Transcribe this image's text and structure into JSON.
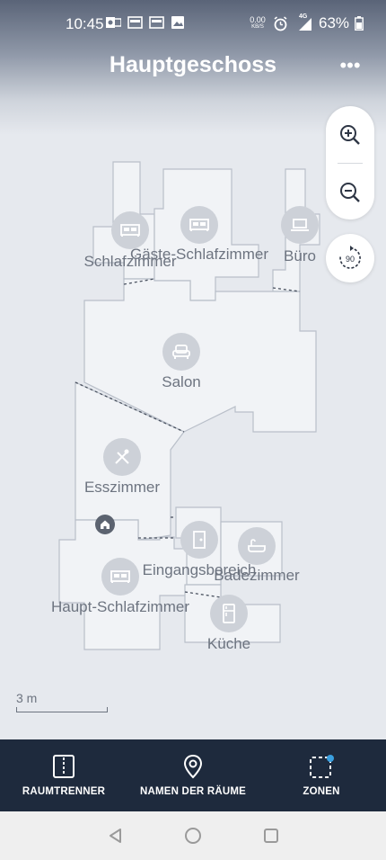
{
  "status_bar": {
    "time": "10:45",
    "net_speed_value": "0.00",
    "net_speed_unit": "KB/S",
    "network_type": "4G",
    "battery": "63%",
    "icons": [
      "outlook-icon",
      "news-icon",
      "news-icon",
      "image-icon",
      "alarm-icon",
      "signal-icon",
      "battery-icon"
    ]
  },
  "header": {
    "title": "Hauptgeschoss",
    "more_label": "•••"
  },
  "controls": {
    "zoom_in": "zoom-in-icon",
    "zoom_out": "zoom-out-icon",
    "rotate_label": "90"
  },
  "map": {
    "rooms": [
      {
        "name": "Schlafzimmer",
        "icon": "bed-icon"
      },
      {
        "name": "Gäste-Schlafzimmer",
        "icon": "bed-icon"
      },
      {
        "name": "Büro",
        "icon": "laptop-icon"
      },
      {
        "name": "Salon",
        "icon": "armchair-icon"
      },
      {
        "name": "Esszimmer",
        "icon": "cutlery-icon"
      },
      {
        "name": "Eingangsbereich",
        "icon": "door-icon"
      },
      {
        "name": "Badezimmer",
        "icon": "bathtub-icon"
      },
      {
        "name": "Haupt-Schlafzimmer",
        "icon": "bed-icon"
      },
      {
        "name": "Küche",
        "icon": "fridge-icon"
      }
    ],
    "dock": "home-icon",
    "scale": "3 m",
    "colors": {
      "room_fill": "#f1f3f6",
      "room_stroke": "#b9bfc9",
      "icon_circle": "#cdd1d8",
      "label": "#6d7480"
    }
  },
  "bottom_bar": {
    "items": [
      {
        "label": "RAUMTRENNER",
        "icon": "room-divider-icon"
      },
      {
        "label": "NAMEN DER RÄUME",
        "icon": "location-pin-icon"
      },
      {
        "label": "ZONEN",
        "icon": "zones-icon"
      }
    ],
    "background": "#1e2a3d",
    "notification_dot": "#3aa0e0"
  },
  "nav_bar": {
    "buttons": [
      "back-icon",
      "home-nav-icon",
      "recents-icon"
    ]
  }
}
